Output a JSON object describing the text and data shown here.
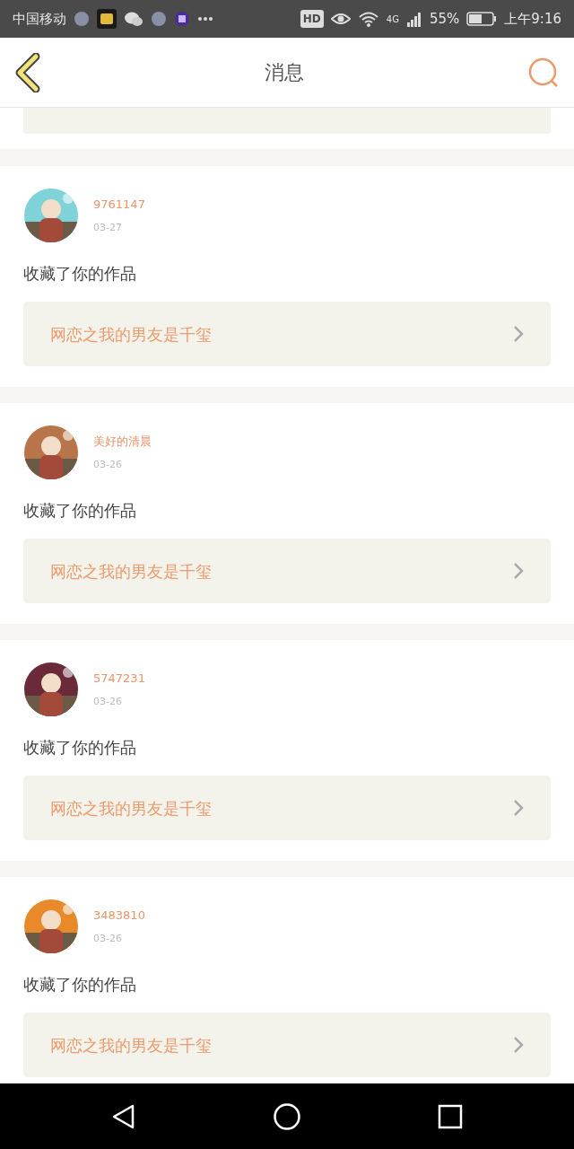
{
  "status_bar": {
    "carrier": "中国移动",
    "network": "HD",
    "signal_type": "4G",
    "battery": "55%",
    "time": "上午9:16"
  },
  "header": {
    "title": "消息"
  },
  "messages": [
    {
      "name": "9761147",
      "date": "03-27",
      "action": "收藏了你的作品",
      "work": "网恋之我的男友是千玺"
    },
    {
      "name": "美好的清晨",
      "date": "03-26",
      "action": "收藏了你的作品",
      "work": "网恋之我的男友是千玺"
    },
    {
      "name": "5747231",
      "date": "03-26",
      "action": "收藏了你的作品",
      "work": "网恋之我的男友是千玺"
    },
    {
      "name": "3483810",
      "date": "03-26",
      "action": "收藏了你的作品",
      "work": "网恋之我的男友是千玺"
    }
  ]
}
